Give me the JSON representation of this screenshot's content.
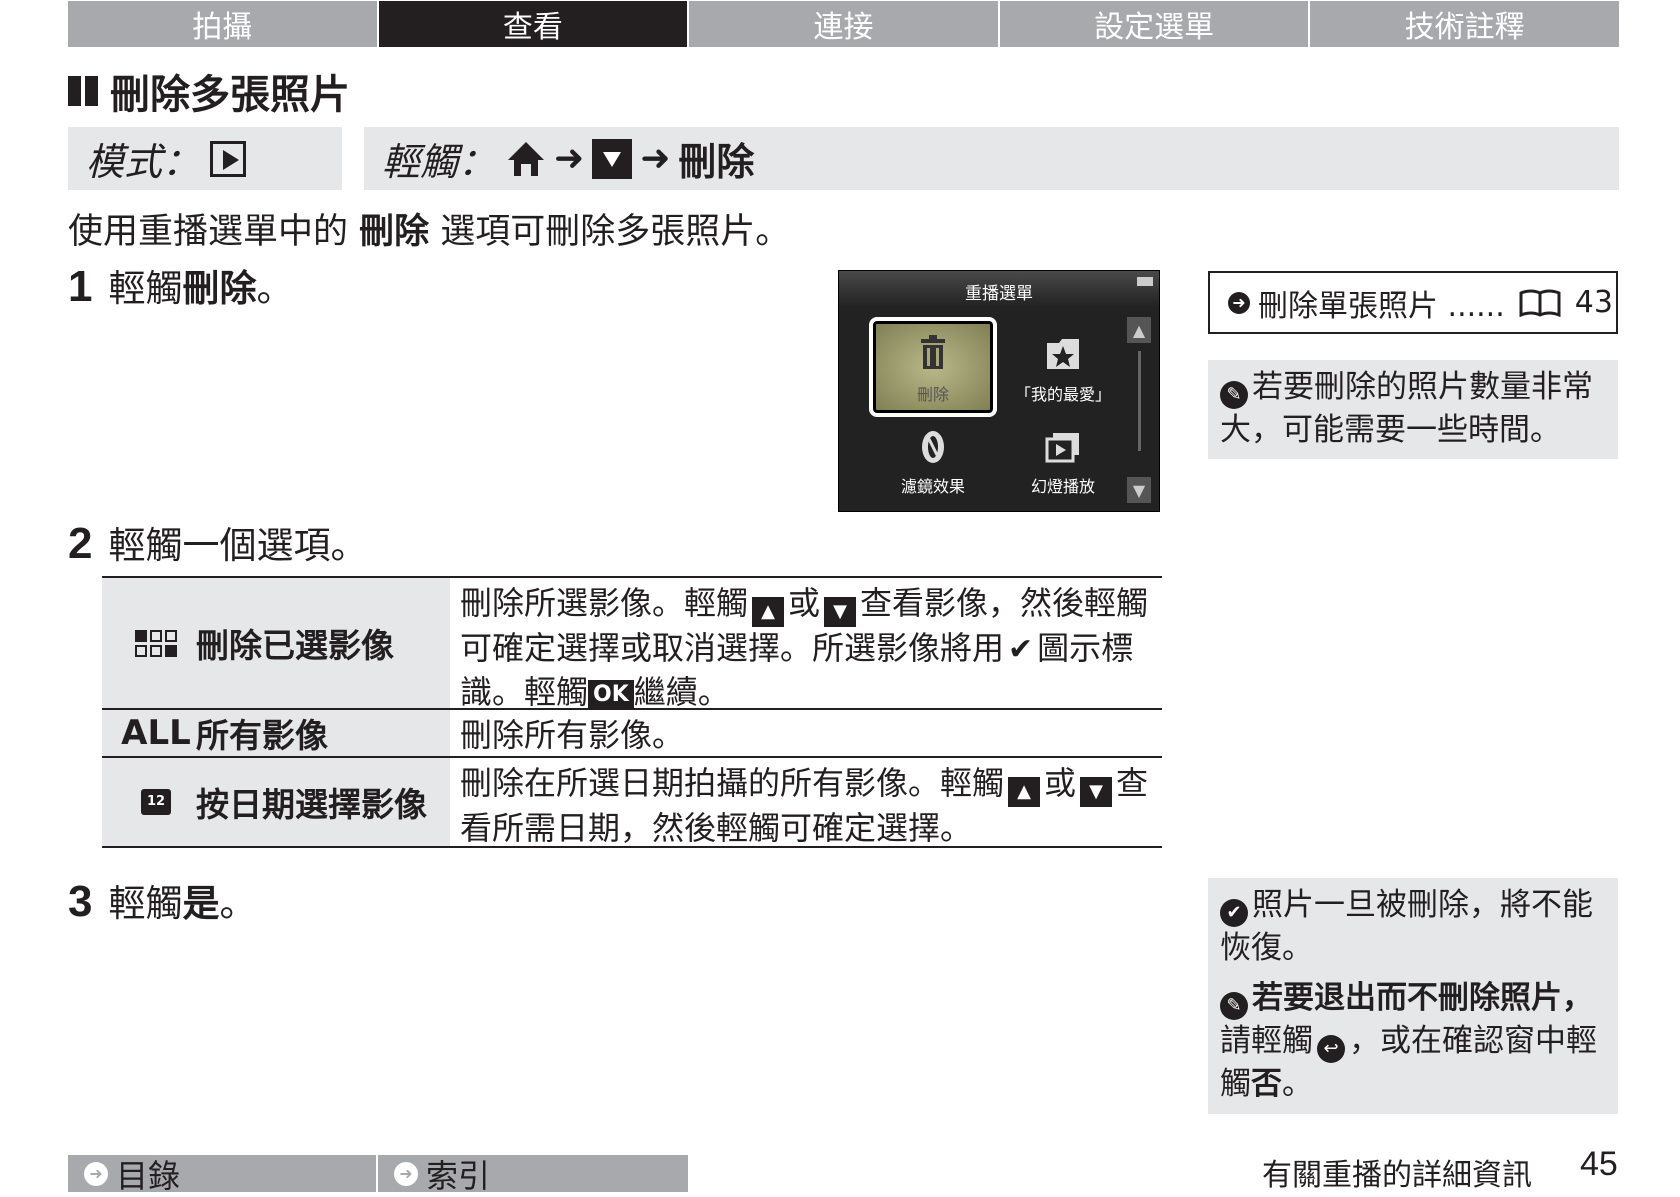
{
  "tabs": [
    "拍攝",
    "查看",
    "連接",
    "設定選單",
    "技術註釋"
  ],
  "active_tab": "查看",
  "section_title": "刪除多張照片",
  "mode_bar": {
    "label": "模式："
  },
  "touch_bar": {
    "label": "輕觸：",
    "final": "刪除"
  },
  "intro": {
    "before": "使用重播選單中的 ",
    "bold": "刪除",
    "after": " 選項可刪除多張照片。"
  },
  "steps": [
    {
      "num": "1",
      "prefix": "輕觸 ",
      "bold": "刪除",
      "suffix": "。"
    },
    {
      "num": "2",
      "text": "輕觸一個選項。"
    },
    {
      "num": "3",
      "prefix": "輕觸 ",
      "bold": "是",
      "suffix": "。"
    }
  ],
  "camera_screen": {
    "title": "重播選單",
    "items": [
      "刪除",
      "「我的最愛」",
      "濾鏡效果",
      "幻燈播放"
    ]
  },
  "ref_box": {
    "text": "刪除單張照片 ......",
    "page": "43"
  },
  "note_top": "若要刪除的照片數量非常大，可能需要一些時間。",
  "table": [
    {
      "icon_text": "",
      "name": "刪除已選影像",
      "desc_1": "刪除所選影像。輕觸",
      "desc_2": "或",
      "desc_3": "查看影像，然後輕觸可確定選擇或取消選擇。所選影像將用",
      "desc_4": "圖示標識。輕觸",
      "desc_5": "繼續。"
    },
    {
      "icon_text": "ALL",
      "name": "所有影像",
      "desc": "刪除所有影像。"
    },
    {
      "icon_text": "12",
      "name": "按日期選擇影像",
      "desc_1": "刪除在所選日期拍攝的所有影像。輕觸",
      "desc_2": "或",
      "desc_3": "查看所需日期，然後輕觸可確定選擇。"
    }
  ],
  "ok_label": "OK",
  "note_bottom_1": "照片一旦被刪除，將不能恢復。",
  "note_bottom_2": {
    "bold": "若要退出而不刪除照片，",
    "text_1": "請輕觸",
    "text_2": "，或在確認窗中輕觸",
    "bold_2": "否",
    "text_3": "。"
  },
  "footer": {
    "toc": "目錄",
    "index": "索引",
    "caption": "有關重播的詳細資訊",
    "page": "45"
  }
}
